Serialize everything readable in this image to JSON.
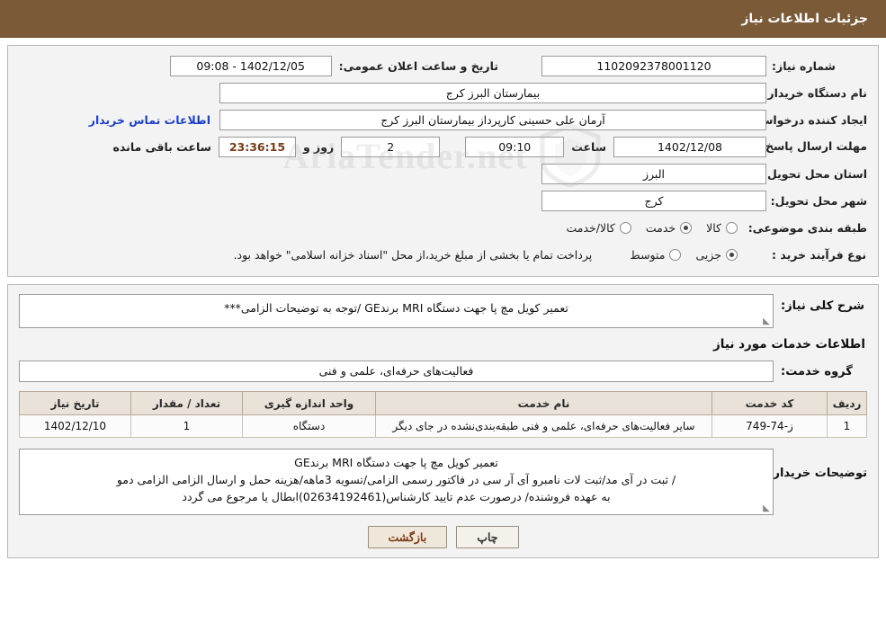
{
  "header": {
    "title": "جزئیات اطلاعات نیاز"
  },
  "form": {
    "need_number_label": "شماره نیاز:",
    "need_number_value": "1102092378001120",
    "announce_date_label": "تاریخ و ساعت اعلان عمومی:",
    "announce_date_value": "1402/12/05 - 09:08",
    "buyer_org_label": "نام دستگاه خریدار:",
    "buyer_org_value": "بیمارستان البرز کرج",
    "requester_label": "ایجاد کننده درخواست:",
    "requester_value": "آرمان علی حسینی کارپرداز بیمارستان البرز کرج",
    "contact_link": "اطلاعات تماس خریدار",
    "deadline_label": "مهلت ارسال پاسخ: تا تاریخ:",
    "deadline_date": "1402/12/08",
    "time_label": "ساعت",
    "deadline_time": "09:10",
    "days_value": "2",
    "days_label": "روز و",
    "countdown_value": "23:36:15",
    "remaining_label": "ساعت باقی مانده",
    "province_label": "استان محل تحویل:",
    "province_value": "البرز",
    "city_label": "شهر محل تحویل:",
    "city_value": "کرج",
    "category_label": "طبقه بندی موضوعی:",
    "category_options": [
      {
        "label": "کالا",
        "selected": false
      },
      {
        "label": "خدمت",
        "selected": true
      },
      {
        "label": "کالا/خدمت",
        "selected": false
      }
    ],
    "process_label": "نوع فرآیند خرید :",
    "process_options": [
      {
        "label": "جزیی",
        "selected": true
      },
      {
        "label": "متوسط",
        "selected": false
      }
    ],
    "process_note": "پرداخت تمام یا بخشی از مبلغ خرید،از محل \"اسناد خزانه اسلامی\" خواهد بود."
  },
  "watermark": {
    "text": "AriaTender.net"
  },
  "details": {
    "summary_label": "شرح کلی نیاز:",
    "summary_value": "تعمیر کویل مچ پا جهت دستگاه MRI برندGE /توجه به توضیحات الزامی***",
    "services_title": "اطلاعات خدمات مورد نیاز",
    "group_label": "گروه خدمت:",
    "group_value": "فعالیت‌های حرفه‌ای، علمی و فنی"
  },
  "table": {
    "headers": [
      "ردیف",
      "کد خدمت",
      "نام خدمت",
      "واحد اندازه گیری",
      "تعداد / مقدار",
      "تاریخ نیاز"
    ],
    "rows": [
      {
        "index": "1",
        "code": "ز-74-749",
        "name": "سایر فعالیت‌های حرفه‌ای، علمی و فنی طبقه‌بندی‌نشده در جای دیگر",
        "unit": "دستگاه",
        "qty": "1",
        "date": "1402/12/10"
      }
    ]
  },
  "buyer_notes": {
    "label": "توضیحات خریدار:",
    "lines": [
      "تعمیر کویل مچ پا جهت دستگاه MRI برندGE",
      "/ ثبت در آی مد/ثبت لات نامبرو آی آر سی در فاکتور رسمی الزامی/تسویه 3ماهه/هزینه حمل و ارسال الزامی الزامی دمو",
      "به عهده فروشنده/ درصورت عدم تایید کارشناس(02634192461)ابطال یا مرجوع می گردد"
    ]
  },
  "footer": {
    "print_label": "چاپ",
    "back_label": "بازگشت"
  }
}
